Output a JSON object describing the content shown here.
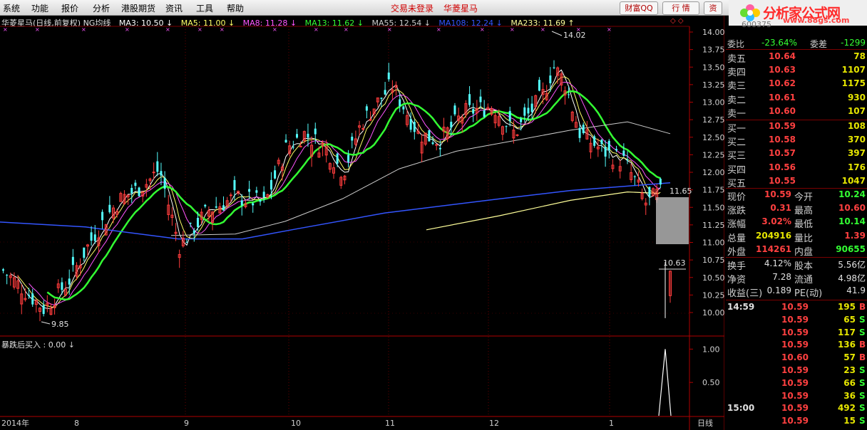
{
  "menu": {
    "items": [
      "系统",
      "功能",
      "报价",
      "分析",
      "港股期货",
      "资讯",
      "工具",
      "帮助"
    ],
    "trade_status": "交易未登录",
    "stock_name": "华菱星马",
    "buttons": [
      "财富QQ",
      "行 情",
      "资"
    ]
  },
  "logo": {
    "text": "分析家公式网",
    "url": "www.88gs.com"
  },
  "chart_header": {
    "title": "华菱星马(日线,前复权) NG均线",
    "ma": [
      {
        "label": "MA3: 10.50",
        "arrow": "↓",
        "color": "#ffffff"
      },
      {
        "label": "MA5: 11.00",
        "arrow": "↓",
        "color": "#ffff66"
      },
      {
        "label": "MA8: 11.28",
        "arrow": "↓",
        "color": "#ff55ff"
      },
      {
        "label": "MA13: 11.62",
        "arrow": "↓",
        "color": "#33ff33"
      },
      {
        "label": "MA55: 12.54",
        "arrow": "↓",
        "color": "#cccccc"
      },
      {
        "label": "MA108: 12.24",
        "arrow": "↓",
        "color": "#3355ff"
      },
      {
        "label": "MA233: 11.69",
        "arrow": "↑",
        "color": "#ffff99"
      }
    ]
  },
  "chart_data": [
    {
      "type": "candlestick",
      "title": "华菱星马(日线,前复权)",
      "ylim": [
        9.8,
        14.1
      ],
      "y_ticks": [
        "14.00",
        "13.75",
        "13.50",
        "13.25",
        "13.00",
        "12.75",
        "12.50",
        "12.25",
        "12.00",
        "11.75",
        "11.50",
        "11.25",
        "11.00",
        "10.75",
        "10.50",
        "10.25",
        "10.00"
      ],
      "x_ticks": [
        "2014年",
        "8",
        "9",
        "10",
        "11",
        "12",
        "1",
        "日线"
      ],
      "annotations": [
        {
          "text": "14.02"
        },
        {
          "text": "9.85"
        },
        {
          "text": "10.63"
        },
        {
          "text": "11.65"
        }
      ],
      "ma_values": {
        "MA3": 10.5,
        "MA5": 11.0,
        "MA8": 11.28,
        "MA13": 11.62,
        "MA55": 12.54,
        "MA108": 12.24,
        "MA233": 11.69
      }
    },
    {
      "type": "line",
      "title": "暴跌后买入",
      "label": "暴跌后买入 : 0.00",
      "ylim": [
        0,
        1.1
      ],
      "y_ticks": [
        "1.00",
        "0.50"
      ],
      "series": [
        {
          "name": "暴跌后买入",
          "last_value": 0.0,
          "spike_value": 1.0
        }
      ]
    }
  ],
  "quote": {
    "top_partial": {
      "lbl": "委比",
      "val": "-23.64%",
      "lbl2": "委差",
      "cnt": "-1299"
    },
    "asks": [
      {
        "lbl": "卖五",
        "price": "10.64",
        "vol": "78"
      },
      {
        "lbl": "卖四",
        "price": "10.63",
        "vol": "1107"
      },
      {
        "lbl": "卖三",
        "price": "10.62",
        "vol": "1175"
      },
      {
        "lbl": "卖二",
        "price": "10.61",
        "vol": "930"
      },
      {
        "lbl": "卖一",
        "price": "10.60",
        "vol": "107"
      }
    ],
    "bids": [
      {
        "lbl": "买一",
        "price": "10.59",
        "vol": "108"
      },
      {
        "lbl": "买二",
        "price": "10.58",
        "vol": "370"
      },
      {
        "lbl": "买三",
        "price": "10.57",
        "vol": "397"
      },
      {
        "lbl": "买四",
        "price": "10.56",
        "vol": "176"
      },
      {
        "lbl": "买五",
        "price": "10.55",
        "vol": "1047"
      }
    ],
    "stats": [
      {
        "l1": "现价",
        "v1": "10.59",
        "l2": "今开",
        "v2": "10.24",
        "c1": "#ff4040",
        "c2": "#33ff33"
      },
      {
        "l1": "涨跌",
        "v1": "0.31",
        "l2": "最高",
        "v2": "10.60",
        "c1": "#ff4040",
        "c2": "#ff4040"
      },
      {
        "l1": "涨幅",
        "v1": "3.02%",
        "l2": "最低",
        "v2": "10.14",
        "c1": "#ff4040",
        "c2": "#33ff33"
      },
      {
        "l1": "总量",
        "v1": "204916",
        "l2": "量比",
        "v2": "1.39",
        "c1": "#e6e600",
        "c2": "#ff4040"
      },
      {
        "l1": "外盘",
        "v1": "114261",
        "l2": "内盘",
        "v2": "90655",
        "c1": "#ff4040",
        "c2": "#33ff33"
      }
    ],
    "finance": [
      {
        "l1": "换手",
        "v1": "4.12%",
        "l2": "股本",
        "v2": "5.56亿"
      },
      {
        "l1": "净资",
        "v1": "7.28",
        "l2": "流通",
        "v2": "4.98亿"
      },
      {
        "l1": "收益(三)",
        "v1": "0.189",
        "l2": "PE(动)",
        "v2": "41.9"
      }
    ],
    "ticks": [
      {
        "time": "14:59",
        "price": "10.59",
        "vol": "195",
        "bs": "B"
      },
      {
        "time": "",
        "price": "10.59",
        "vol": "65",
        "bs": "S"
      },
      {
        "time": "",
        "price": "10.59",
        "vol": "117",
        "bs": "S"
      },
      {
        "time": "",
        "price": "10.59",
        "vol": "136",
        "bs": "B"
      },
      {
        "time": "",
        "price": "10.60",
        "vol": "57",
        "bs": "B"
      },
      {
        "time": "",
        "price": "10.59",
        "vol": "23",
        "bs": "S"
      },
      {
        "time": "",
        "price": "10.59",
        "vol": "66",
        "bs": "S"
      },
      {
        "time": "",
        "price": "10.59",
        "vol": "36",
        "bs": "S"
      },
      {
        "time": "15:00",
        "price": "10.59",
        "vol": "492",
        "bs": "S"
      },
      {
        "time": "",
        "price": "10.59",
        "vol": "15",
        "bs": "S"
      }
    ]
  },
  "partial_code": "600375"
}
